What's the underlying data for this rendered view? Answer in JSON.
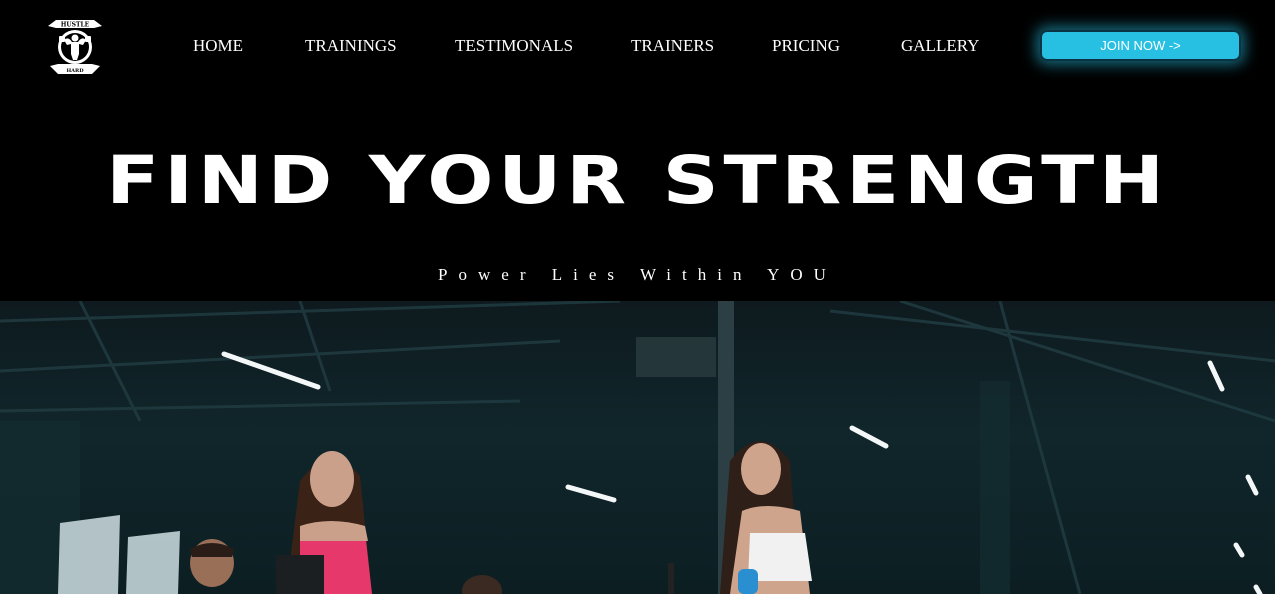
{
  "brand": {
    "logo_text_top": "HUSTLE",
    "logo_text_bottom": "HARD",
    "logo_icon": "bodybuilder-emblem-icon"
  },
  "nav": {
    "items": [
      {
        "label": "HOME"
      },
      {
        "label": "TRAININGS"
      },
      {
        "label": "TESTIMONALS"
      },
      {
        "label": "TRAINERS"
      },
      {
        "label": "PRICING"
      },
      {
        "label": "GALLERY"
      }
    ],
    "cta_label": "JOIN NOW ->"
  },
  "hero": {
    "title": "FIND YOUR STRENGTH",
    "subtitle": "Power Lies Within YOU"
  },
  "colors": {
    "background": "#000000",
    "accent": "#27c0e2",
    "text": "#ffffff"
  }
}
